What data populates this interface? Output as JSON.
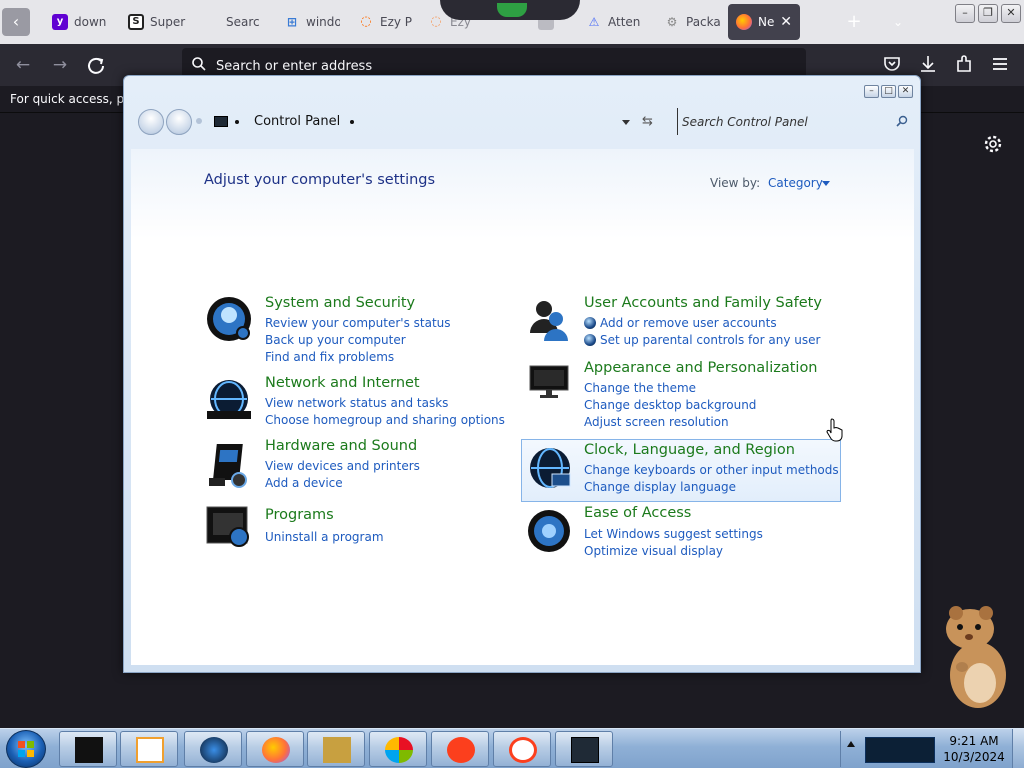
{
  "browser": {
    "tabs": [
      {
        "label": "down",
        "icon": "yahoo-icon",
        "color": "#6001d2"
      },
      {
        "label": "Super",
        "icon": "superuser-icon",
        "color": "#222222"
      },
      {
        "label": "Searc",
        "icon": "search-page-icon",
        "color": "#888888"
      },
      {
        "label": "windo",
        "icon": "windows-icon",
        "color": "#3a7bd5"
      },
      {
        "label": "Ezy P",
        "icon": "ezy-icon",
        "color": "#ff6a00"
      },
      {
        "label": "Ezy",
        "icon": "ezy-icon",
        "color": "#ff6a00"
      },
      {
        "label": "",
        "icon": "page-icon",
        "color": "#888888"
      },
      {
        "label": "Atten",
        "icon": "attention-icon",
        "color": "#4a6cf7"
      },
      {
        "label": "Packa",
        "icon": "package-icon",
        "color": "#888888"
      },
      {
        "label": "Ne",
        "icon": "firefox-icon",
        "color": "#ff7139"
      }
    ],
    "address_placeholder": "Search or enter address",
    "bookmarks_hint": "For quick access, plac"
  },
  "control_panel": {
    "breadcrumb": "Control Panel",
    "search_placeholder": "Search Control Panel",
    "heading": "Adjust your computer's settings",
    "view_by_label": "View by:",
    "view_by_value": "Category",
    "categories": [
      {
        "title": "System and Security",
        "icon": "system-security-icon",
        "links": [
          "Review your computer's status",
          "Back up your computer",
          "Find and fix problems"
        ]
      },
      {
        "title": "Network and Internet",
        "icon": "network-icon",
        "links": [
          "View network status and tasks",
          "Choose homegroup and sharing options"
        ]
      },
      {
        "title": "Hardware and Sound",
        "icon": "hardware-icon",
        "links": [
          "View devices and printers",
          "Add a device"
        ]
      },
      {
        "title": "Programs",
        "icon": "programs-icon",
        "links": [
          "Uninstall a program"
        ]
      },
      {
        "title": "User Accounts and Family Safety",
        "icon": "users-icon",
        "links": [
          "Add or remove user accounts",
          "Set up parental controls for any user"
        ]
      },
      {
        "title": "Appearance and Personalization",
        "icon": "appearance-icon",
        "links": [
          "Change the theme",
          "Change desktop background",
          "Adjust screen resolution"
        ]
      },
      {
        "title": "Clock, Language, and Region",
        "icon": "clock-globe-icon",
        "links": [
          "Change keyboards or other input methods",
          "Change display language"
        ]
      },
      {
        "title": "Ease of Access",
        "icon": "ease-access-icon",
        "links": [
          "Let Windows suggest settings",
          "Optimize visual display"
        ]
      }
    ]
  },
  "taskbar": {
    "time": "9:21 AM",
    "date": "10/3/2024",
    "pinned": [
      "explorer-icon",
      "media-player-icon",
      "globe-icon",
      "firefox-icon",
      "box-game-icon",
      "color-wheel-icon",
      "yandex-icon",
      "yandex-browser-icon",
      "control-panel-icon"
    ]
  },
  "colors": {
    "link": "#1e5bbf",
    "category_title": "#1c7a1c",
    "heading": "#1e3287",
    "browser_bg": "#1c1b22"
  }
}
